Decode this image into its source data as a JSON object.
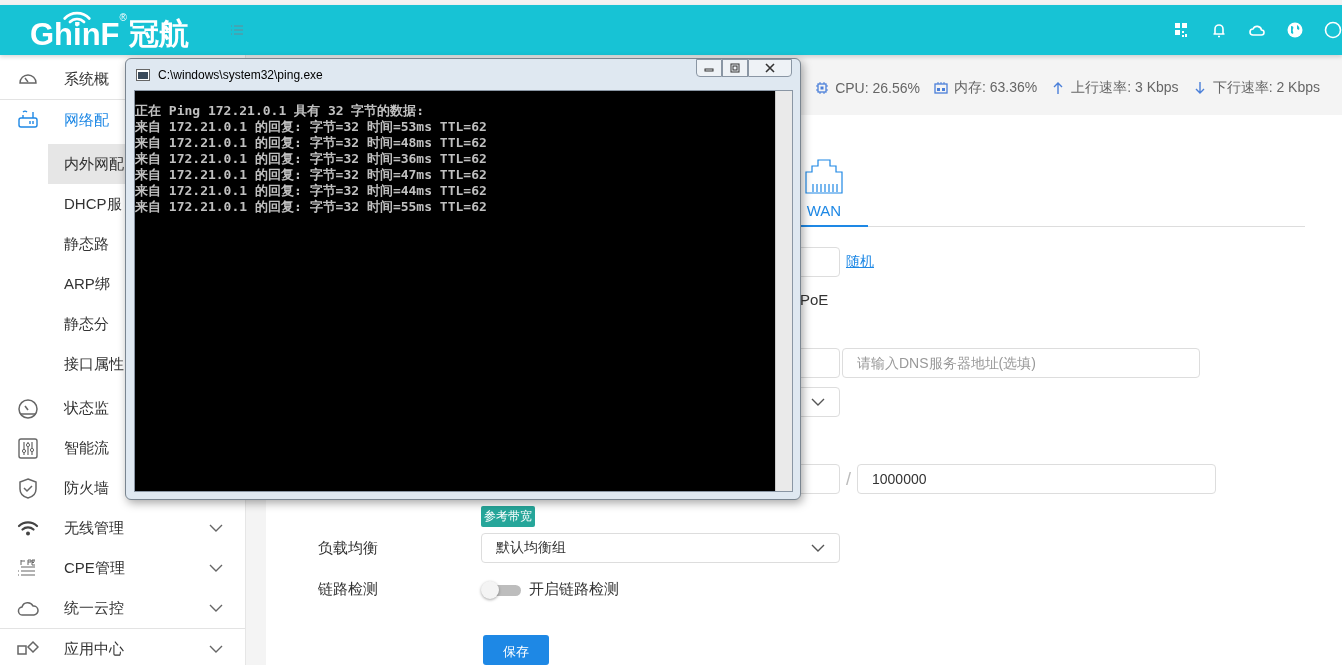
{
  "header": {
    "logo_text": "GhinF",
    "logo_mark": "®",
    "logo_cn": "冠航"
  },
  "sidebar": {
    "items": [
      {
        "label": "系统概",
        "kind": "dashboard",
        "selected": false,
        "divider_after": true
      },
      {
        "label": "网络配",
        "kind": "router",
        "selected": true,
        "children": [
          {
            "label": "内外网配",
            "selected": true
          },
          {
            "label": "DHCP服",
            "selected": false
          },
          {
            "label": "静态路",
            "selected": false
          },
          {
            "label": "ARP绑",
            "selected": false
          },
          {
            "label": "静态分",
            "selected": false
          },
          {
            "label": "接口属性",
            "selected": false
          }
        ]
      },
      {
        "label": "状态监",
        "kind": "gauge",
        "selected": false
      },
      {
        "label": "智能流",
        "kind": "sliders",
        "selected": false
      },
      {
        "label": "防火墙",
        "kind": "shield",
        "selected": false
      },
      {
        "label": "无线管理",
        "kind": "wifi",
        "selected": false,
        "expandable": true
      },
      {
        "label": "CPE管理",
        "kind": "cpe",
        "selected": false,
        "expandable": true
      },
      {
        "label": "统一云控",
        "kind": "cloud",
        "selected": false,
        "expandable": true,
        "divider_after": true
      },
      {
        "label": "应用中心",
        "kind": "apps",
        "selected": false,
        "expandable": true
      }
    ]
  },
  "stats": [
    {
      "kind": "cpu",
      "text": "CPU: 26.56%"
    },
    {
      "kind": "memory",
      "text": "内存: 63.36%"
    },
    {
      "kind": "up",
      "text": "上行速率: 3 Kbps"
    },
    {
      "kind": "down",
      "text": "下行速率: 2 Kbps"
    }
  ],
  "tabs": [
    {
      "label": "WAN",
      "selected": true
    }
  ],
  "form": [
    {
      "kind": "input_link",
      "link": "随机"
    },
    {
      "kind": "text",
      "text": "PoE"
    },
    {
      "kind": "dual_input",
      "placeholder": "请输入DNS服务器地址(选填)"
    },
    {
      "kind": "select"
    },
    {
      "kind": "ratio",
      "separator": "/",
      "value": "1000000",
      "badge": "参考带宽"
    },
    {
      "kind": "select",
      "label": "负载均衡",
      "value": "默认均衡组"
    },
    {
      "kind": "toggle",
      "label": "链路检测",
      "on": false,
      "text": "开启链路检测"
    },
    {
      "kind": "button",
      "text": "保存"
    }
  ],
  "console": {
    "title": "C:\\windows\\system32\\ping.exe",
    "lines": [
      "正在 Ping 172.21.0.1 具有 32 字节的数据:",
      "来自 172.21.0.1 的回复: 字节=32 时间=53ms TTL=62",
      "来自 172.21.0.1 的回复: 字节=32 时间=48ms TTL=62",
      "来自 172.21.0.1 的回复: 字节=32 时间=36ms TTL=62",
      "来自 172.21.0.1 的回复: 字节=32 时间=47ms TTL=62",
      "来自 172.21.0.1 的回复: 字节=32 时间=44ms TTL=62",
      "来自 172.21.0.1 的回复: 字节=32 时间=55ms TTL=62"
    ]
  }
}
